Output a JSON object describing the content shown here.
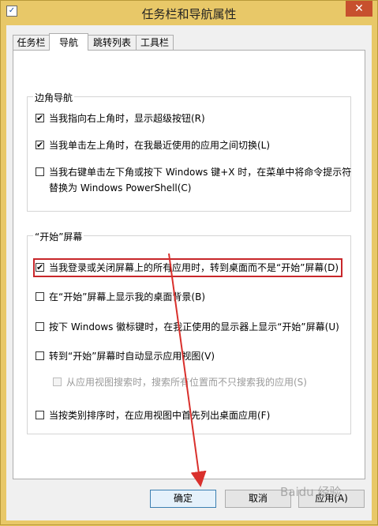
{
  "window": {
    "title": "任务栏和导航属性"
  },
  "tabs": [
    {
      "label": "任务栏",
      "active": false
    },
    {
      "label": "导航",
      "active": true
    },
    {
      "label": "跳转列表",
      "active": false
    },
    {
      "label": "工具栏",
      "active": false
    }
  ],
  "corner_nav": {
    "title": "边角导航",
    "options": [
      {
        "label": "当我指向右上角时，显示超级按钮(R)",
        "checked": true
      },
      {
        "label": "当我单击左上角时，在我最近使用的应用之间切换(L)",
        "checked": true
      },
      {
        "label_line1": "当我右键单击左下角或按下 Windows 键+X 时，在菜单中将命令提示符",
        "label_line2": "替换为 Windows PowerShell(C)",
        "checked": false
      }
    ]
  },
  "start_screen": {
    "title": "“开始”屏幕",
    "options": [
      {
        "label": "当我登录或关闭屏幕上的所有应用时，转到桌面而不是“开始”屏幕(D)",
        "checked": true
      },
      {
        "label": "在“开始”屏幕上显示我的桌面背景(B)",
        "checked": false
      },
      {
        "label": "按下 Windows 徽标键时，在我正使用的显示器上显示“开始”屏幕(U)",
        "checked": false
      },
      {
        "label": "转到“开始”屏幕时自动显示应用视图(V)",
        "checked": false
      },
      {
        "label": "从应用视图搜索时，搜索所有位置而不只搜索我的应用(S)",
        "checked": false,
        "disabled": true
      },
      {
        "label": "当按类别排序时，在应用视图中首先列出桌面应用(F)",
        "checked": false
      }
    ]
  },
  "buttons": {
    "ok": "确定",
    "cancel": "取消",
    "apply": "应用(A)"
  },
  "check_mark": "✔",
  "close_glyph": "✕",
  "app_icon_glyph": "✓",
  "watermark": "Baidu 经验",
  "colors": {
    "highlight": "#c8262a",
    "arrow": "#d9302c",
    "title_bar": "#e8c868"
  }
}
